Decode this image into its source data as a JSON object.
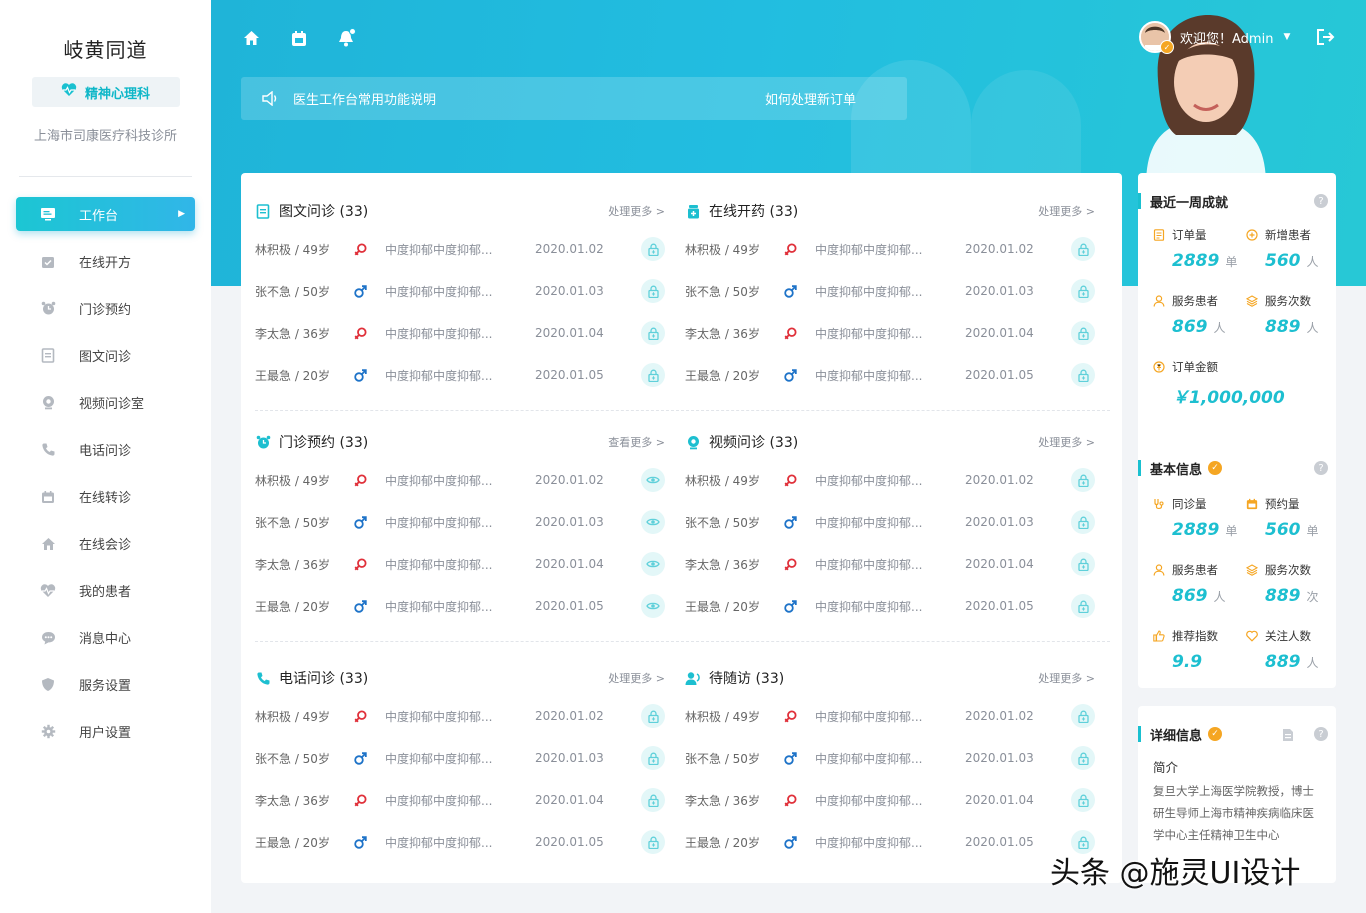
{
  "sidebar": {
    "brand": "岐黄同道",
    "department": "精神心理科",
    "clinic": "上海市司康医疗科技诊所",
    "items": [
      {
        "label": "工作台",
        "icon": "dashboard-icon",
        "active": true
      },
      {
        "label": "在线开方",
        "icon": "prescription-icon"
      },
      {
        "label": "门诊预约",
        "icon": "alarm-clock-icon"
      },
      {
        "label": "图文问诊",
        "icon": "document-icon"
      },
      {
        "label": "视频问诊室",
        "icon": "camera-icon"
      },
      {
        "label": "电话问诊",
        "icon": "phone-icon"
      },
      {
        "label": "在线转诊",
        "icon": "calendar-icon"
      },
      {
        "label": "在线会诊",
        "icon": "house-icon"
      },
      {
        "label": "我的患者",
        "icon": "heart-pulse-icon"
      },
      {
        "label": "消息中心",
        "icon": "chat-icon"
      },
      {
        "label": "服务设置",
        "icon": "shield-icon"
      },
      {
        "label": "用户设置",
        "icon": "gear-icon"
      }
    ]
  },
  "header": {
    "icons": [
      "home-icon",
      "calendar-icon",
      "bell-icon"
    ],
    "notice_text": "医生工作台常用功能说明",
    "notice_link": "如何处理新订单",
    "greeting": "欢迎您！Admin",
    "colors": {
      "accent": "#1dbfd0",
      "male": "#1e73c8",
      "female": "#e0303a"
    }
  },
  "sections": [
    {
      "title": "图文问诊 (33)",
      "more": "处理更多 >",
      "icon": "document-icon",
      "action": "lock-icon"
    },
    {
      "title": "在线开药 (33)",
      "more": "处理更多 >",
      "icon": "medicine-icon",
      "action": "lock-icon"
    },
    {
      "title": "门诊预约 (33)",
      "more": "查看更多 >",
      "icon": "alarm-clock-icon",
      "action": "eye-icon"
    },
    {
      "title": "视频问诊 (33)",
      "more": "处理更多 >",
      "icon": "camera-icon",
      "action": "lock-icon"
    },
    {
      "title": "电话问诊 (33)",
      "more": "处理更多 >",
      "icon": "phone-icon",
      "action": "lock-icon"
    },
    {
      "title": "待随访 (33)",
      "more": "处理更多 >",
      "icon": "follow-up-icon",
      "action": "lock-icon"
    }
  ],
  "rows": [
    {
      "name": "林积极 / 49岁",
      "gender": "female",
      "desc": "中度抑郁中度抑郁...",
      "date": "2020.01.02"
    },
    {
      "name": "张不急 / 50岁",
      "gender": "male",
      "desc": "中度抑郁中度抑郁...",
      "date": "2020.01.03"
    },
    {
      "name": "李太急 / 36岁",
      "gender": "female",
      "desc": "中度抑郁中度抑郁...",
      "date": "2020.01.04"
    },
    {
      "name": "王最急 / 20岁",
      "gender": "male",
      "desc": "中度抑郁中度抑郁...",
      "date": "2020.01.05"
    }
  ],
  "weekly": {
    "title": "最近一周成就",
    "stats": [
      {
        "label": "订单量",
        "value": "2889",
        "unit": "单",
        "icon": "order-icon"
      },
      {
        "label": "新增患者",
        "value": "560",
        "unit": "人",
        "icon": "plus-circle-icon"
      },
      {
        "label": "服务患者",
        "value": "869",
        "unit": "人",
        "icon": "user-icon"
      },
      {
        "label": "服务次数",
        "value": "889",
        "unit": "人",
        "icon": "layers-icon"
      },
      {
        "label": "订单金额",
        "value": "￥1,000,000",
        "unit": "",
        "icon": "coin-icon"
      }
    ]
  },
  "basic": {
    "title": "基本信息",
    "stats": [
      {
        "label": "同诊量",
        "value": "2889",
        "unit": "单",
        "icon": "stethoscope-icon"
      },
      {
        "label": "预约量",
        "value": "560",
        "unit": "单",
        "icon": "calendar-icon"
      },
      {
        "label": "服务患者",
        "value": "869",
        "unit": "人",
        "icon": "user-icon"
      },
      {
        "label": "服务次数",
        "value": "889",
        "unit": "次",
        "icon": "layers-icon"
      },
      {
        "label": "推荐指数",
        "value": "9.9",
        "unit": "",
        "icon": "thumbs-up-icon"
      },
      {
        "label": "关注人数",
        "value": "889",
        "unit": "人",
        "icon": "heart-icon"
      }
    ]
  },
  "detail": {
    "title": "详细信息",
    "subtitle": "简介",
    "text": "复旦大学上海医学院教授，博士研生导师上海市精神疾病临床医学中心主任精神卫生中心"
  },
  "watermark": "头条 @施灵UI设计"
}
